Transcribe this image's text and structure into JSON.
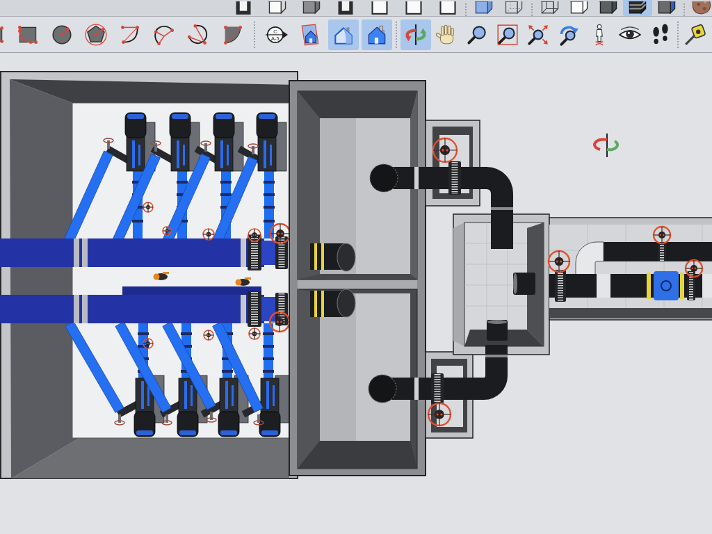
{
  "style_toolbar": {
    "groups": [
      {
        "buttons": [
          {
            "kind": "darkbox",
            "selected": false
          },
          {
            "kind": "cube",
            "selected": false
          },
          {
            "kind": "graycube",
            "selected": false
          },
          {
            "kind": "darkbox",
            "selected": false
          },
          {
            "kind": "whitebox",
            "selected": false
          },
          {
            "kind": "whitebox",
            "selected": false
          },
          {
            "kind": "whitebox",
            "selected": false
          }
        ]
      },
      {
        "buttons": [
          {
            "kind": "xray",
            "selected": false
          },
          {
            "kind": "wirecube",
            "selected": false
          }
        ]
      },
      {
        "buttons": [
          {
            "kind": "wireframe",
            "selected": false
          },
          {
            "kind": "hiddenline",
            "selected": false
          },
          {
            "kind": "shaded",
            "selected": false
          },
          {
            "kind": "textured",
            "selected": true
          },
          {
            "kind": "monochrome",
            "selected": false
          }
        ]
      },
      {
        "buttons": [
          {
            "kind": "texture",
            "selected": false
          }
        ]
      }
    ]
  },
  "main_toolbar": {
    "groups": [
      {
        "buttons": [
          {
            "kind": "rectangle",
            "selected": false
          },
          {
            "kind": "quarter",
            "selected": false
          },
          {
            "kind": "circle",
            "selected": false
          },
          {
            "kind": "polygon",
            "selected": false
          },
          {
            "kind": "arc",
            "selected": false
          },
          {
            "kind": "threepoint",
            "selected": false
          },
          {
            "kind": "twopoint",
            "selected": false
          },
          {
            "kind": "pie",
            "selected": false
          }
        ]
      },
      {
        "buttons": [
          {
            "kind": "section",
            "selected": false,
            "label_top": "C",
            "label_bottom": "A-5"
          },
          {
            "kind": "sectiondisplay",
            "selected": false
          },
          {
            "kind": "sectioncuts",
            "selected": true
          },
          {
            "kind": "sectionfill",
            "selected": true
          }
        ]
      },
      {
        "buttons": [
          {
            "kind": "orbit",
            "selected": true
          },
          {
            "kind": "pan",
            "selected": false
          },
          {
            "kind": "zoom",
            "selected": false
          },
          {
            "kind": "zoomwindow",
            "selected": false
          },
          {
            "kind": "extents",
            "selected": false
          },
          {
            "kind": "previous",
            "selected": false
          },
          {
            "kind": "camera",
            "selected": false
          },
          {
            "kind": "lookaround",
            "selected": false
          },
          {
            "kind": "walk",
            "selected": false
          }
        ]
      },
      {
        "buttons": [
          {
            "kind": "tape",
            "selected": false
          }
        ]
      }
    ]
  }
}
